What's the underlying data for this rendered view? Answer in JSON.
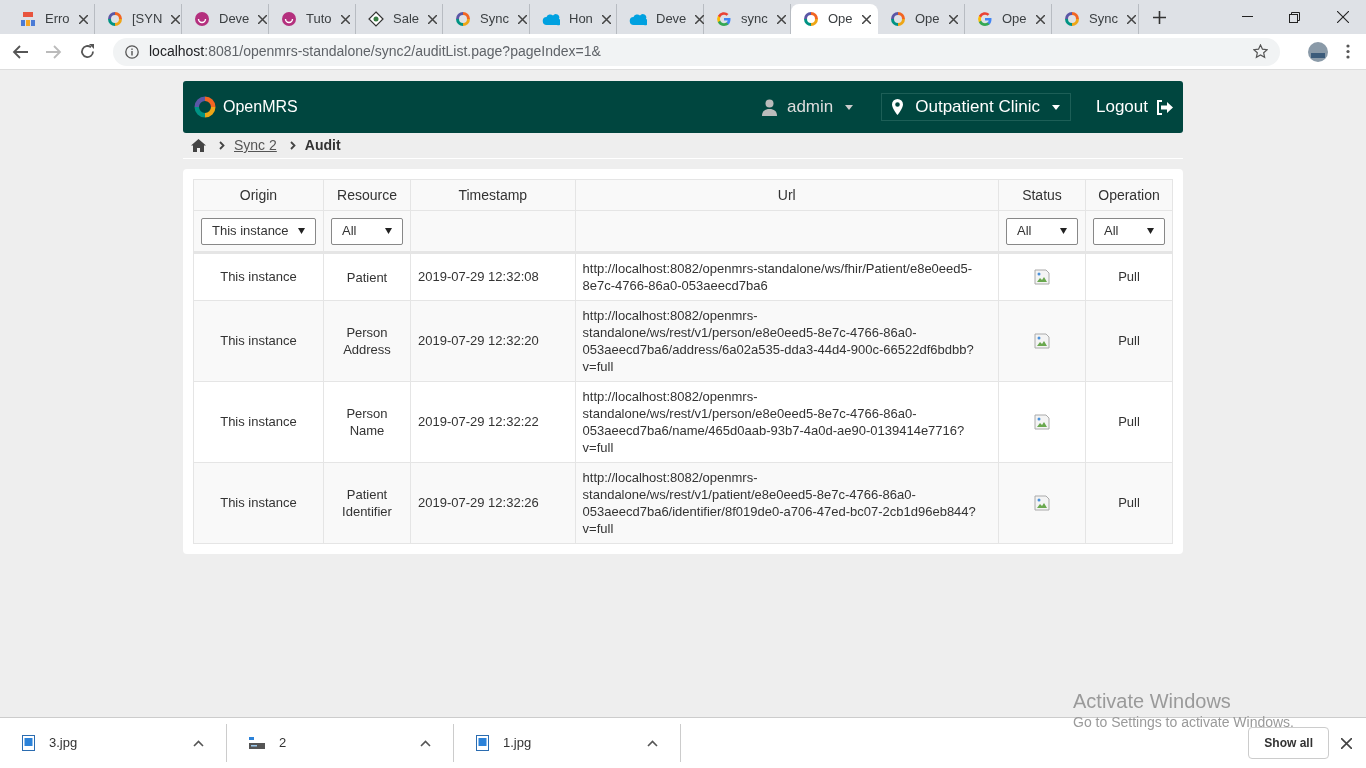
{
  "browser": {
    "tabs": [
      {
        "title": "Erro",
        "kind": "chart",
        "selected": false
      },
      {
        "title": "[SYN",
        "kind": "openmrs",
        "selected": false
      },
      {
        "title": "Deve",
        "kind": "smile",
        "selected": false
      },
      {
        "title": "Tuto",
        "kind": "smile",
        "selected": false
      },
      {
        "title": "Sale",
        "kind": "diamond",
        "selected": false
      },
      {
        "title": "Sync",
        "kind": "openmrs",
        "selected": false
      },
      {
        "title": "Hon",
        "kind": "cloud",
        "selected": false
      },
      {
        "title": "Deve",
        "kind": "cloud",
        "selected": false
      },
      {
        "title": "sync",
        "kind": "google",
        "selected": false
      },
      {
        "title": "Ope",
        "kind": "openmrs",
        "selected": true
      },
      {
        "title": "Ope",
        "kind": "openmrs",
        "selected": false
      },
      {
        "title": "Ope",
        "kind": "google",
        "selected": false
      },
      {
        "title": "Sync",
        "kind": "openmrs",
        "selected": false
      }
    ],
    "address": {
      "host": "localhost",
      "path": ":8081/openmrs-standalone/sync2/auditList.page?pageIndex=1&"
    },
    "downloads": [
      {
        "name": "3.jpg",
        "kind": "image"
      },
      {
        "name": "2",
        "kind": "folder"
      },
      {
        "name": "1.jpg",
        "kind": "image"
      }
    ],
    "show_all": "Show all"
  },
  "header": {
    "brand": "OpenMRS",
    "user": "admin",
    "location": "Outpatient Clinic",
    "logout": "Logout"
  },
  "breadcrumb": [
    "Sync 2",
    "Audit"
  ],
  "table": {
    "columns": [
      {
        "label": "Origin",
        "filter": "This instance"
      },
      {
        "label": "Resource",
        "filter": "All"
      },
      {
        "label": "Timestamp"
      },
      {
        "label": "Url"
      },
      {
        "label": "Status",
        "filter": "All"
      },
      {
        "label": "Operation",
        "filter": "All"
      }
    ],
    "rows": [
      {
        "origin": "This instance",
        "resource": "Patient",
        "timestamp": "2019-07-29 12:32:08",
        "url": "http://localhost:8082/openmrs-standalone/ws/fhir/Patient/e8e0eed5-8e7c-4766-86a0-053aeecd7ba6",
        "operation": "Pull"
      },
      {
        "origin": "This instance",
        "resource": "Person Address",
        "timestamp": "2019-07-29 12:32:20",
        "url": "http://localhost:8082/openmrs-standalone/ws/rest/v1/person/e8e0eed5-8e7c-4766-86a0-053aeecd7ba6/address/6a02a535-dda3-44d4-900c-66522df6bdbb?v=full",
        "operation": "Pull"
      },
      {
        "origin": "This instance",
        "resource": "Person Name",
        "timestamp": "2019-07-29 12:32:22",
        "url": "http://localhost:8082/openmrs-standalone/ws/rest/v1/person/e8e0eed5-8e7c-4766-86a0-053aeecd7ba6/name/465d0aab-93b7-4a0d-ae90-0139414e7716?v=full",
        "operation": "Pull"
      },
      {
        "origin": "This instance",
        "resource": "Patient Identifier",
        "timestamp": "2019-07-29 12:32:26",
        "url": "http://localhost:8082/openmrs-standalone/ws/rest/v1/patient/e8e0eed5-8e7c-4766-86a0-053aeecd7ba6/identifier/8f019de0-a706-47ed-bc07-2cb1d96eb844?v=full",
        "operation": "Pull"
      }
    ]
  },
  "os_notice": {
    "title": "Activate Windows",
    "text": "Go to Settings to activate Windows."
  }
}
